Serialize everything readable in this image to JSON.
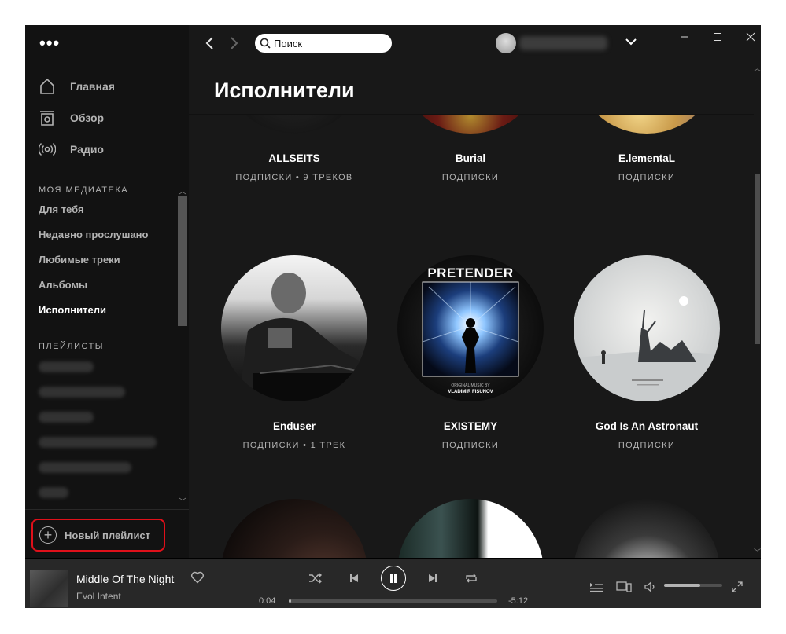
{
  "sidebar": {
    "menu_icon": "ellipsis-icon",
    "nav": [
      {
        "label": "Главная",
        "icon": "home-icon"
      },
      {
        "label": "Обзор",
        "icon": "browse-icon"
      },
      {
        "label": "Радио",
        "icon": "radio-icon"
      }
    ],
    "library_title": "МОЯ МЕДИАТЕКА",
    "library": [
      {
        "label": "Для тебя"
      },
      {
        "label": "Недавно прослушано"
      },
      {
        "label": "Любимые треки"
      },
      {
        "label": "Альбомы"
      },
      {
        "label": "Исполнители",
        "active": true
      }
    ],
    "playlists_title": "ПЛЕЙЛИСТЫ",
    "new_playlist": "Новый плейлист"
  },
  "topbar": {
    "search_placeholder": "Поиск"
  },
  "main": {
    "title": "Исполнители",
    "artists": [
      {
        "name": "ALLSEITS",
        "meta": "ПОДПИСКИ • 9 ТРЕКОВ"
      },
      {
        "name": "Burial",
        "meta": "ПОДПИСКИ"
      },
      {
        "name": "E.lementaL",
        "meta": "ПОДПИСКИ"
      },
      {
        "name": "Enduser",
        "meta": "ПОДПИСКИ • 1 ТРЕК"
      },
      {
        "name": "EXISTEMY",
        "meta": "ПОДПИСКИ"
      },
      {
        "name": "God Is An Astronaut",
        "meta": "ПОДПИСКИ"
      }
    ],
    "existemy_art": {
      "line1": "PRETENDER",
      "line2": "ORIGINAL MUSIC BY",
      "line3": "VLADIMIR FISUNOV"
    }
  },
  "player": {
    "track_title": "Middle Of The Night",
    "artist": "Evol Intent",
    "elapsed": "0:04",
    "remaining": "-5:12",
    "progress_fraction": 0.01,
    "volume_fraction": 0.62
  },
  "colors": {
    "accent_highlight": "#e0101a",
    "background": "#181818",
    "sidebar": "#121212",
    "player": "#282828"
  }
}
